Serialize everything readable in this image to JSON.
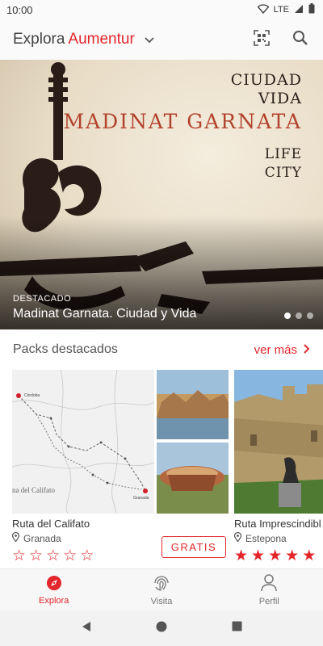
{
  "status": {
    "time": "10:00",
    "network": "LTE"
  },
  "header": {
    "brand_prefix": "Explora",
    "brand_accent": "Aumentur",
    "accent_color": "#e3262c"
  },
  "hero": {
    "art_text": {
      "line1": "CIUDAD",
      "line2": "VIDA",
      "main": "MADINAT GARNATA",
      "line3": "LIFE",
      "line4": "CITY"
    },
    "badge": "DESTACADO",
    "title": "Madinat Garnata. Ciudad y Vida",
    "slides": 3,
    "active_slide": 1
  },
  "packs": {
    "title": "Packs destacados",
    "see_more": "ver más",
    "items": [
      {
        "name": "Ruta del Califato",
        "location": "Granada",
        "rating": 0,
        "max_rating": 5,
        "price_label": "GRATIS",
        "map_text": "na del Califato",
        "map_places": [
          "Córdoba",
          "Granada"
        ]
      },
      {
        "name": "Ruta Imprescindibl",
        "location": "Estepona",
        "rating": 5,
        "max_rating": 5
      }
    ]
  },
  "bottom_nav": [
    {
      "label": "Explora",
      "icon": "compass-icon",
      "active": true
    },
    {
      "label": "Visita",
      "icon": "fingerprint-icon",
      "active": false
    },
    {
      "label": "Perfil",
      "icon": "person-icon",
      "active": false
    }
  ]
}
